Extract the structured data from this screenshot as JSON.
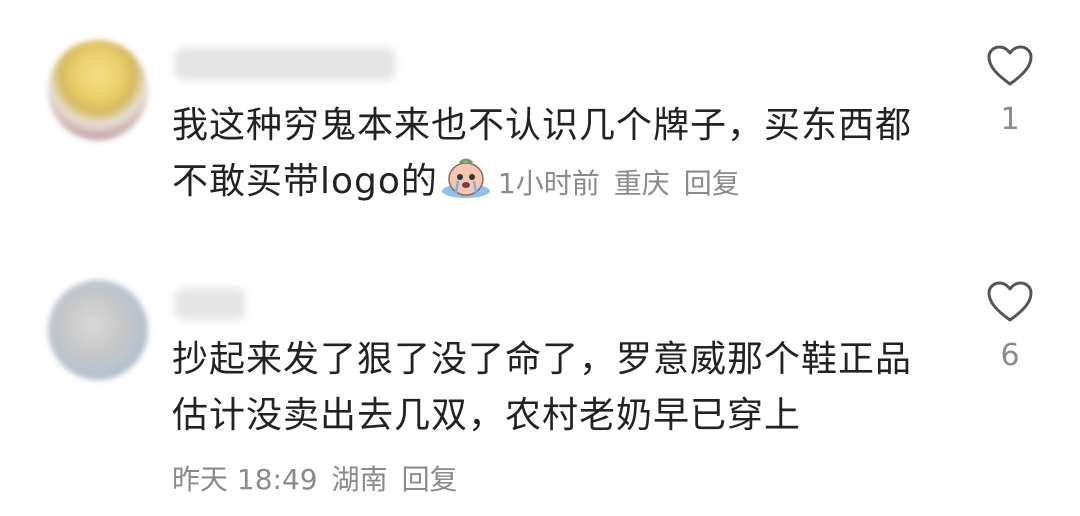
{
  "comments": [
    {
      "text_line1": "我这种穷鬼本来也不认识几个牌子，买东西都",
      "text_line2": "不敢买带logo的",
      "time": "1小时前",
      "location": "重庆",
      "reply_label": "回复",
      "likes": "1",
      "emoji": "crying-face-emoji"
    },
    {
      "text_line1": "抄起来发了狠了没了命了，罗意威那个鞋正品",
      "text_line2": "估计没卖出去几双，农村老奶早已穿上",
      "time": "昨天 18:49",
      "location": "湖南",
      "reply_label": "回复",
      "likes": "6"
    }
  ],
  "colors": {
    "text": "#222222",
    "meta": "#8a8a8a",
    "heart_outline": "#555555"
  }
}
